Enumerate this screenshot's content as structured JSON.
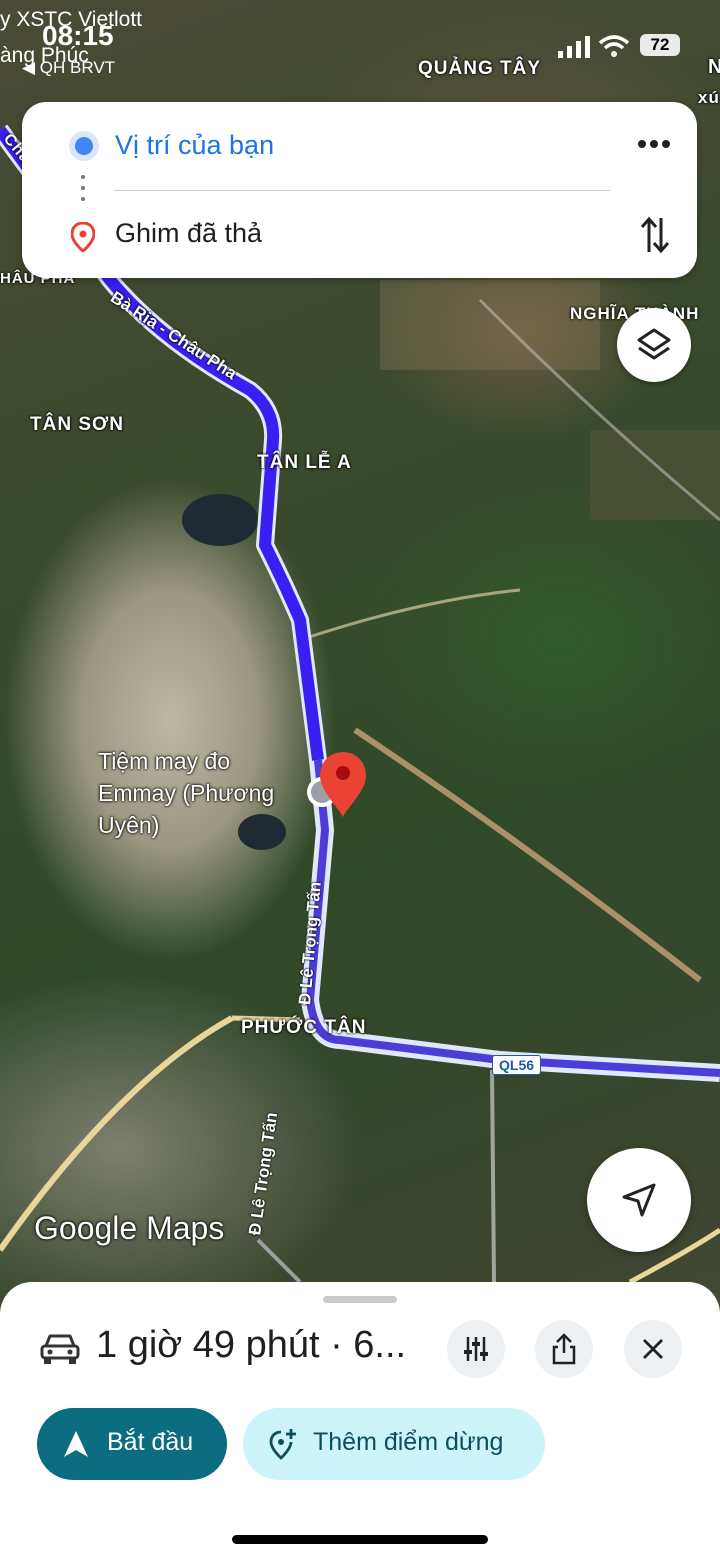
{
  "status_bar": {
    "time": "08:15",
    "carrier_line1": "y XSTC Vietlott",
    "carrier_line2": "àng Phúc",
    "back_label": "◀ QH BRVT",
    "battery": "72",
    "icons": [
      "signal-icon",
      "wifi-icon",
      "battery-icon"
    ]
  },
  "directions": {
    "origin": "Vị trí của bạn",
    "destination": "Ghim đã thả",
    "more_icon": "more-icon",
    "swap_icon": "swap-icon"
  },
  "map": {
    "place_labels": {
      "quang_tay": "QUẢNG TÂY",
      "nghia_thanh": "NGHĨA THÀNH",
      "tan_son": "TÂN SƠN",
      "tan_le_a": "TÂN LỄ A",
      "phuoc_tan": "PHƯỚC TÂN",
      "chau_pha_edge": "HÂU PHA",
      "cha_edge": "Cha",
      "xu_edge": "xú",
      "n_edge": "N"
    },
    "road_labels": {
      "ba_ria": "Bà Rịa - Châu Pha",
      "le_trong_tan_1": "Đ Lê Trọng Tấn",
      "le_trong_tan_2": "Đ Lê Trọng Tấn",
      "ql56": "QL56"
    },
    "poi": "Tiệm may đo Emmay (Phương Uyên)",
    "logo": "Google Maps",
    "route_color": "#3b1ef0",
    "pin_color": "#ea4335"
  },
  "sheet": {
    "summary": "1 giờ 49 phút · 6...",
    "start_label": "Bắt đầu",
    "add_stop_label": "Thêm điểm dừng"
  }
}
